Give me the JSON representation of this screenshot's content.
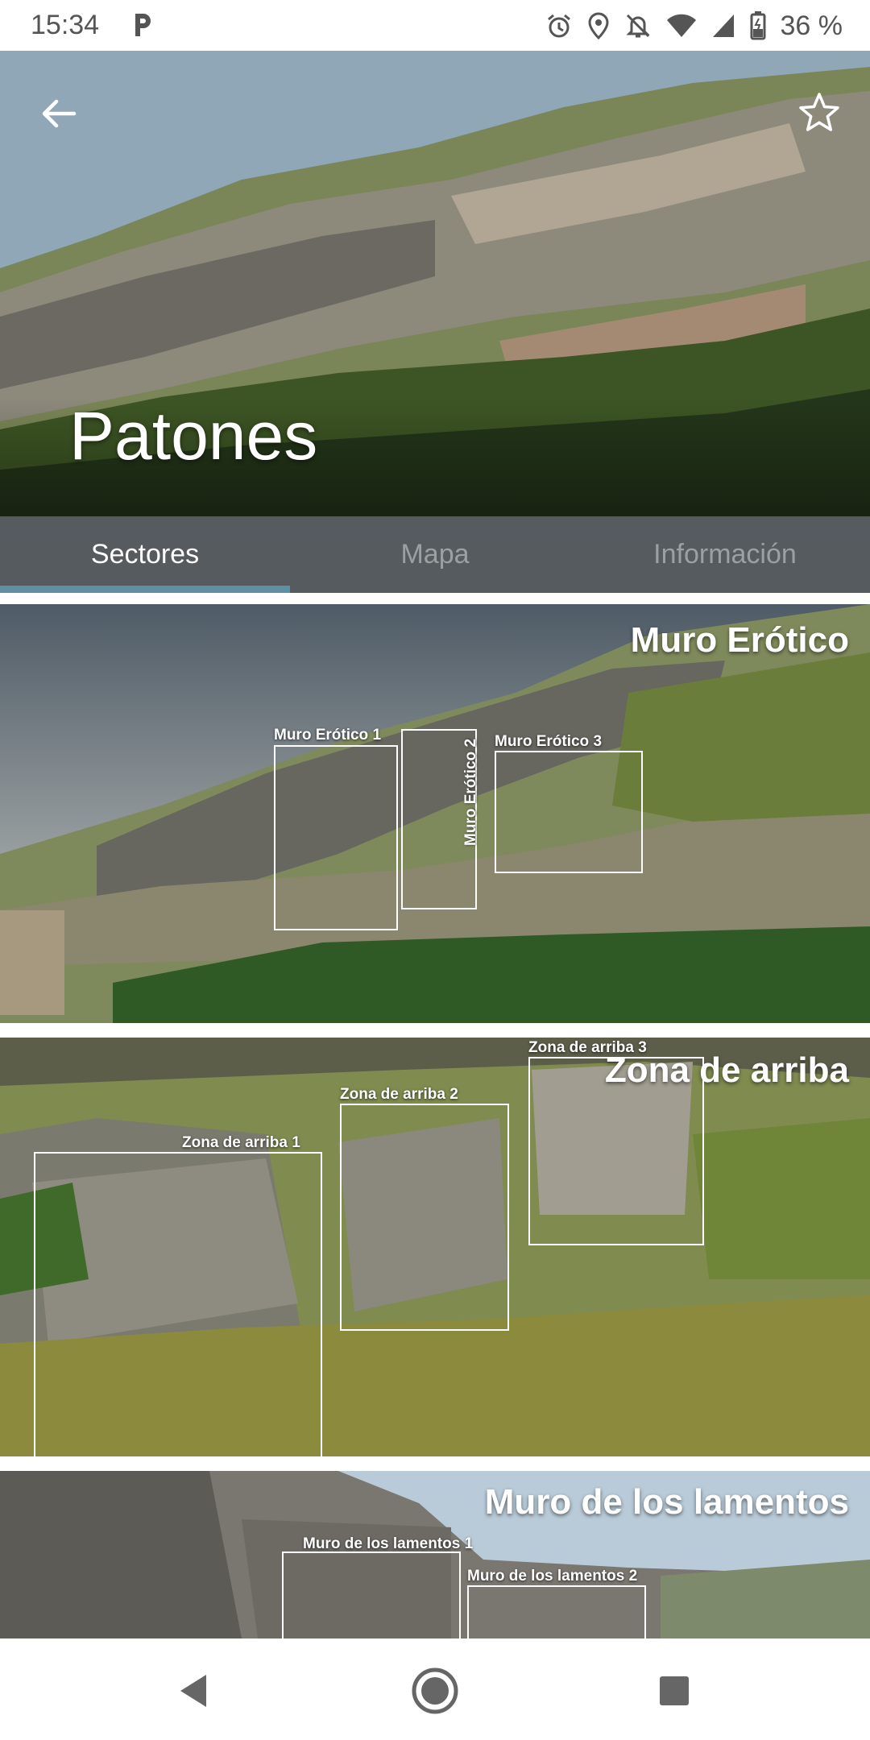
{
  "status_bar": {
    "time": "15:34",
    "battery_percent": "36 %",
    "icons": [
      "parking-icon",
      "alarm-icon",
      "location-icon",
      "notifications-off-icon",
      "wifi-icon",
      "signal-icon",
      "battery-icon"
    ]
  },
  "hero": {
    "title": "Patones",
    "back_icon": "arrow-back-icon",
    "favorite_icon": "star-outline-icon"
  },
  "tabs": [
    {
      "label": "Sectores",
      "active": true
    },
    {
      "label": "Mapa",
      "active": false
    },
    {
      "label": "Información",
      "active": false
    }
  ],
  "sectors": [
    {
      "title": "Muro Erótico",
      "subzones": [
        "Muro Erótico 1",
        "Muro Erótico 2",
        "Muro Erótico 3"
      ]
    },
    {
      "title": "Zona de arriba",
      "subzones": [
        "Zona de arriba 1",
        "Zona de arriba 2",
        "Zona de arriba 3"
      ]
    },
    {
      "title": "Muro de los lamentos",
      "subzones": [
        "Muro de los lamentos 1",
        "Muro de los lamentos 2"
      ]
    }
  ],
  "nav_bar": {
    "icons": [
      "back-triangle-icon",
      "home-circle-icon",
      "recents-square-icon"
    ]
  },
  "colors": {
    "tab_bar": "#555b5e",
    "tab_indicator": "#5f8fa3",
    "tab_inactive_text": "#9ba0a3"
  }
}
